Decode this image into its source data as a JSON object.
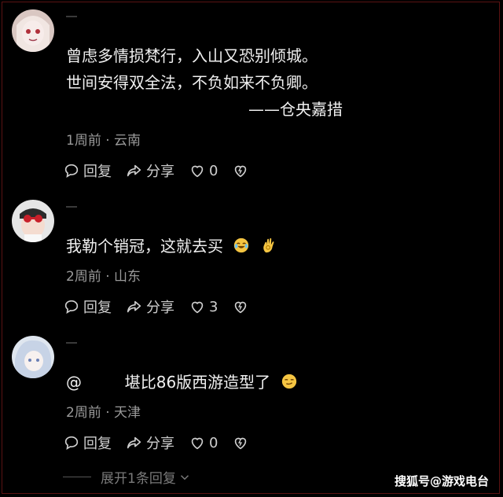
{
  "comments": [
    {
      "lines": [
        "曾虑多情损梵行，入山又恐别倾城。",
        "世间安得双全法，不负如来不负卿。",
        "——仓央嘉措"
      ],
      "meta": "1周前 · 云南",
      "reply_label": "回复",
      "share_label": "分享",
      "likes": "0"
    },
    {
      "text": "我勒个销冠，这就去买",
      "meta": "2周前 · 山东",
      "reply_label": "回复",
      "share_label": "分享",
      "likes": "3"
    },
    {
      "mention": "@",
      "text": "堪比86版西游造型了",
      "meta": "2周前 · 天津",
      "reply_label": "回复",
      "share_label": "分享",
      "likes": "0"
    }
  ],
  "expand_label": "展开1条回复",
  "watermark": "搜狐号@游戏电台",
  "colors": {
    "background": "#000000",
    "meta": "#9a9a9a",
    "border": "#5a1212"
  }
}
